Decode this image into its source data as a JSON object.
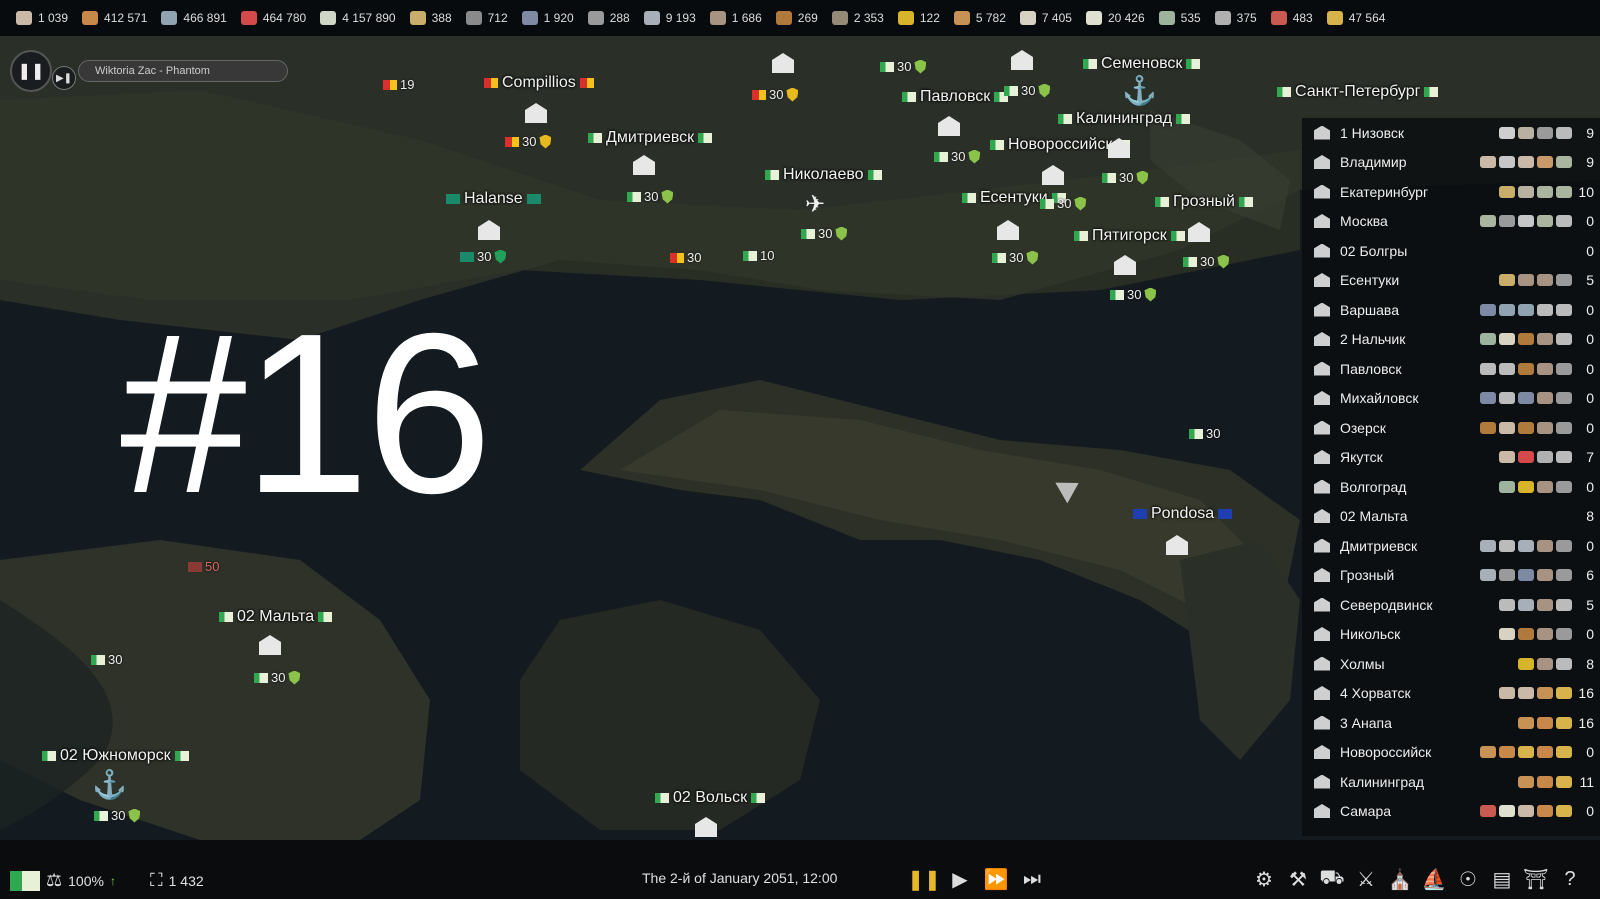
{
  "resources": [
    {
      "icon": "paper-icon",
      "value": "1 039",
      "color": "#c9b9a6"
    },
    {
      "icon": "bread-icon",
      "value": "412 571",
      "color": "#c8884a"
    },
    {
      "icon": "feather-icon",
      "value": "466 891",
      "color": "#8fa3b0"
    },
    {
      "icon": "can-icon",
      "value": "464 780",
      "color": "#d44a4a"
    },
    {
      "icon": "money-icon",
      "value": "4 157 890",
      "color": "#cfd6c6"
    },
    {
      "icon": "grain-icon",
      "value": "388",
      "color": "#c9ad6a"
    },
    {
      "icon": "ore-icon",
      "value": "712",
      "color": "#8a8a8a"
    },
    {
      "icon": "ingot-icon",
      "value": "1 920",
      "color": "#7e8aa3"
    },
    {
      "icon": "stone-icon",
      "value": "288",
      "color": "#9a9a9a"
    },
    {
      "icon": "steel-icon",
      "value": "9 193",
      "color": "#a7b0b8"
    },
    {
      "icon": "sand-icon",
      "value": "1 686",
      "color": "#a89382"
    },
    {
      "icon": "plank-icon",
      "value": "269",
      "color": "#b07a3c"
    },
    {
      "icon": "coal-icon",
      "value": "2 353",
      "color": "#948a76"
    },
    {
      "icon": "gold-icon",
      "value": "122",
      "color": "#d8b42a"
    },
    {
      "icon": "wood-icon",
      "value": "5 782",
      "color": "#c79253"
    },
    {
      "icon": "cube-icon",
      "value": "7 405",
      "color": "#d8d2c2"
    },
    {
      "icon": "cotton-icon",
      "value": "20 426",
      "color": "#e0e0d0"
    },
    {
      "icon": "fabric-icon",
      "value": "535",
      "color": "#9eb39e"
    },
    {
      "icon": "bottle-icon",
      "value": "375",
      "color": "#b0b0b0"
    },
    {
      "icon": "meat-icon",
      "value": "483",
      "color": "#c95a52"
    },
    {
      "icon": "corn-icon",
      "value": "47 564",
      "color": "#d8b24a"
    }
  ],
  "player": {
    "track": "Wiktoria Zac - Phantom"
  },
  "overlay_title": "#16",
  "cities": [
    {
      "name": "Compillios",
      "flag": "fr"
    },
    {
      "name": "Дмитриевск",
      "flag": "fg"
    },
    {
      "name": "Halanse",
      "flag": "fw"
    },
    {
      "name": "Николаево",
      "flag": "fg"
    },
    {
      "name": "Павловск",
      "flag": "fg"
    },
    {
      "name": "Семеновск",
      "flag": "fg"
    },
    {
      "name": "Калининград",
      "flag": "fg"
    },
    {
      "name": "Новороссийск",
      "flag": "fg"
    },
    {
      "name": "Есентуки",
      "flag": "fg"
    },
    {
      "name": "Грозный",
      "flag": "fg"
    },
    {
      "name": "Пятигорск",
      "flag": "fg"
    },
    {
      "name": "Санкт-Петербург",
      "flag": "fg"
    },
    {
      "name": "Pondosa",
      "flag": "fb"
    },
    {
      "name": "02 Мальта",
      "flag": "fg"
    },
    {
      "name": "02 Южноморск",
      "flag": "fg"
    },
    {
      "name": "02 Вольск",
      "flag": "fg"
    }
  ],
  "troops": {
    "a": "30",
    "b": "19",
    "c": "10",
    "d": "50"
  },
  "settlements": [
    {
      "name": "1 Низовск",
      "num": "9",
      "goods": [
        "#cfcfcf",
        "#b8b0a0",
        "#9a9a9a",
        "#bbbbbb"
      ]
    },
    {
      "name": "Владимир",
      "num": "9",
      "goods": [
        "#c9b9a6",
        "#c6c6c6",
        "#c9b9a6",
        "#c89a6a",
        "#aab5a0"
      ]
    },
    {
      "name": "Екатеринбург",
      "num": "10",
      "goods": [
        "#c9ad6a",
        "#b8b0a0",
        "#aab5a0",
        "#aab5a0"
      ]
    },
    {
      "name": "Москва",
      "num": "0",
      "goods": [
        "#aab5a0",
        "#9a9a9a",
        "#c6c6c6",
        "#aab5a0",
        "#bbbbbb"
      ]
    },
    {
      "name": "02 Болгры",
      "num": "0",
      "goods": []
    },
    {
      "name": "Есентуки",
      "num": "5",
      "goods": [
        "#c9ad6a",
        "#a89382",
        "#a89382",
        "#9a9a9a"
      ]
    },
    {
      "name": "Варшава",
      "num": "0",
      "goods": [
        "#7e8aa3",
        "#8fa3b0",
        "#8fa3b0",
        "#bbbbbb",
        "#bbbbbb"
      ]
    },
    {
      "name": "2 Нальчик",
      "num": "0",
      "goods": [
        "#9eb39e",
        "#d8d2c2",
        "#b07a3c",
        "#a89382",
        "#bbbbbb"
      ]
    },
    {
      "name": "Павловск",
      "num": "0",
      "goods": [
        "#bbbbbb",
        "#bbbbbb",
        "#b07a3c",
        "#a89382",
        "#9a9a9a"
      ]
    },
    {
      "name": "Михайловск",
      "num": "0",
      "goods": [
        "#7e8aa3",
        "#bbbbbb",
        "#7e8aa3",
        "#a89382",
        "#9a9a9a"
      ]
    },
    {
      "name": "Озерск",
      "num": "0",
      "goods": [
        "#b07a3c",
        "#c9b9a6",
        "#b07a3c",
        "#a89382",
        "#9a9a9a"
      ]
    },
    {
      "name": "Якутск",
      "num": "7",
      "goods": [
        "#c9b9a6",
        "#d44a4a",
        "#b0b0b0",
        "#bbbbbb"
      ]
    },
    {
      "name": "Волгоград",
      "num": "0",
      "goods": [
        "#9eb39e",
        "#d8b42a",
        "#a89382",
        "#9a9a9a"
      ]
    },
    {
      "name": "02 Мальта",
      "num": "8",
      "goods": []
    },
    {
      "name": "Дмитриевск",
      "num": "0",
      "goods": [
        "#a7b0b8",
        "#bbbbbb",
        "#a7b0b8",
        "#a89382",
        "#9a9a9a"
      ]
    },
    {
      "name": "Грозный",
      "num": "6",
      "goods": [
        "#a7b0b8",
        "#9a9a9a",
        "#7e8aa3",
        "#a89382",
        "#9a9a9a"
      ]
    },
    {
      "name": "Северодвинск",
      "num": "5",
      "goods": [
        "#bbbbbb",
        "#a7b0b8",
        "#a89382",
        "#bbbbbb"
      ]
    },
    {
      "name": "Никольск",
      "num": "0",
      "goods": [
        "#d8d2c2",
        "#b07a3c",
        "#a89382",
        "#9a9a9a"
      ]
    },
    {
      "name": "Холмы",
      "num": "8",
      "goods": [
        "#d8b42a",
        "#a89382",
        "#bbbbbb"
      ]
    },
    {
      "name": "4 Хорватск",
      "num": "16",
      "goods": [
        "#c9b9a6",
        "#c9b9a6",
        "#c79253",
        "#d8b24a"
      ]
    },
    {
      "name": "3 Анапа",
      "num": "16",
      "goods": [
        "#c79253",
        "#c8884a",
        "#d8b24a"
      ]
    },
    {
      "name": "Новороссийск",
      "num": "0",
      "goods": [
        "#c79253",
        "#c8884a",
        "#d8b24a",
        "#c8884a",
        "#d8b24a"
      ]
    },
    {
      "name": "Калининград",
      "num": "11",
      "goods": [
        "#c79253",
        "#c8884a",
        "#d8b24a"
      ]
    },
    {
      "name": "Самара",
      "num": "0",
      "goods": [
        "#c95a52",
        "#e0e0d0",
        "#c9b9a6",
        "#c8884a",
        "#d8b24a"
      ]
    }
  ],
  "status": {
    "approval": "100%",
    "population": "1 432",
    "date": "The 2-й of January 2051, 12:00"
  }
}
